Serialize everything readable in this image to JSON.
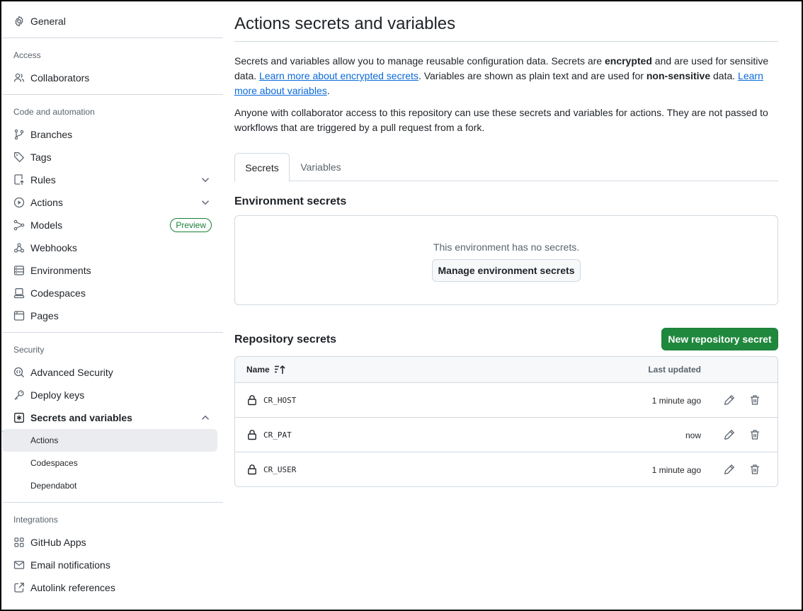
{
  "sidebar": {
    "general": "General",
    "sections": {
      "access": "Access",
      "code_automation": "Code and automation",
      "security": "Security",
      "integrations": "Integrations"
    },
    "items": {
      "collaborators": "Collaborators",
      "branches": "Branches",
      "tags": "Tags",
      "rules": "Rules",
      "actions": "Actions",
      "models": "Models",
      "models_badge": "Preview",
      "webhooks": "Webhooks",
      "environments": "Environments",
      "codespaces": "Codespaces",
      "pages": "Pages",
      "advanced_security": "Advanced Security",
      "deploy_keys": "Deploy keys",
      "secrets_variables": "Secrets and variables",
      "github_apps": "GitHub Apps",
      "email_notifications": "Email notifications",
      "autolink_references": "Autolink references"
    },
    "sub_items": {
      "actions": "Actions",
      "codespaces": "Codespaces",
      "dependabot": "Dependabot"
    }
  },
  "main": {
    "title": "Actions secrets and variables",
    "intro": {
      "p1_a": "Secrets and variables allow you to manage reusable configuration data. Secrets are ",
      "p1_b": "encrypted",
      "p1_c": " and are used for sensitive data. ",
      "p1_link1": "Learn more about encrypted secrets",
      "p1_d": ". Variables are shown as plain text and are used for ",
      "p1_e": "non-sensitive",
      "p1_f": " data. ",
      "p1_link2": "Learn more about variables",
      "p1_g": ".",
      "p2": "Anyone with collaborator access to this repository can use these secrets and variables for actions. They are not passed to workflows that are triggered by a pull request from a fork."
    },
    "tabs": [
      "Secrets",
      "Variables"
    ],
    "env_secrets": {
      "heading": "Environment secrets",
      "empty": "This environment has no secrets.",
      "button": "Manage environment secrets"
    },
    "repo_secrets": {
      "heading": "Repository secrets",
      "new_button": "New repository secret",
      "col_name": "Name",
      "col_updated": "Last updated",
      "rows": [
        {
          "name": "CR_HOST",
          "updated": "1 minute ago"
        },
        {
          "name": "CR_PAT",
          "updated": "now"
        },
        {
          "name": "CR_USER",
          "updated": "1 minute ago"
        }
      ]
    }
  },
  "colors": {
    "accent_blue": "#0969da",
    "primary_green": "#1f883d",
    "preview_green": "#1a7f37",
    "border": "#d1d9e0",
    "muted_text": "#59636e"
  }
}
